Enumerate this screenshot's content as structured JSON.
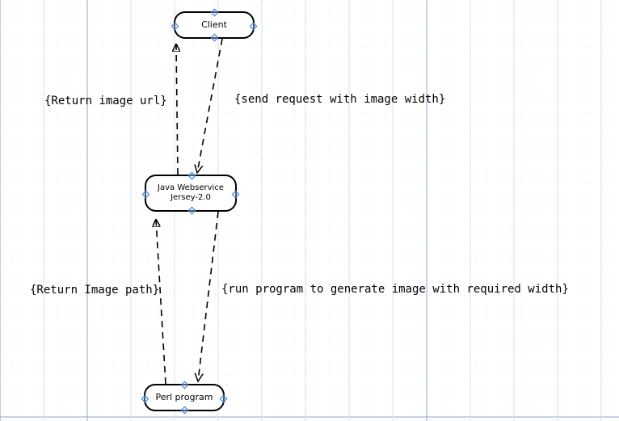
{
  "nodes": {
    "client": {
      "label": "Client"
    },
    "javaws": {
      "label": "Java Webservice\nJersey-2.0"
    },
    "perl": {
      "label": "Perl program"
    }
  },
  "edges": {
    "client_to_java": "{send request with image width}",
    "java_to_client": "{Return image url}",
    "java_to_perl": "{run program to generate image with required width}",
    "perl_to_java": "{Return Image path}"
  }
}
